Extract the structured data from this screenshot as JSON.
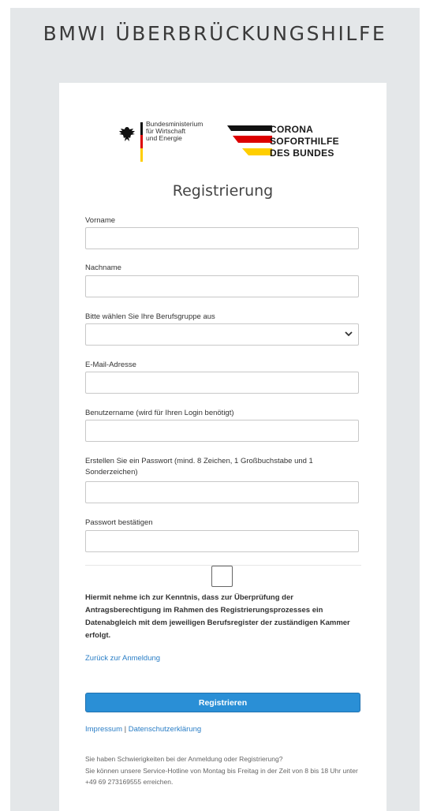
{
  "site": {
    "title": "BMWI ÜBERBRÜCKUNGSHILFE"
  },
  "logos": {
    "bm_lines": "Bundesministerium\nfür Wirtschaft\nund Energie",
    "corona": [
      "CORONA",
      "SOFORTHILFE",
      "DES BUNDES"
    ],
    "colors": {
      "black": "#111111",
      "red": "#dd0000",
      "gold": "#ffce00"
    }
  },
  "form": {
    "title": "Registrierung",
    "fields": {
      "vorname": {
        "label": "Vorname",
        "value": ""
      },
      "nachname": {
        "label": "Nachname",
        "value": ""
      },
      "berufsgruppe": {
        "label": "Bitte wählen Sie Ihre Berufsgruppe aus",
        "value": ""
      },
      "email": {
        "label": "E-Mail-Adresse",
        "value": ""
      },
      "benutzername": {
        "label": "Benutzername (wird für Ihren Login benötigt)",
        "value": ""
      },
      "passwort": {
        "label": "Erstellen Sie ein Passwort (mind. 8 Zeichen, 1 Großbuchstabe und 1 Sonderzeichen)",
        "value": ""
      },
      "passwort_bestaetigen": {
        "label": "Passwort bestätigen",
        "value": ""
      }
    },
    "consent_text": "Hiermit nehme ich zur Kenntnis, dass zur Überprüfung der Antragsberechtigung im Rahmen des Registrierungsprozesses ein Datenabgleich mit dem jeweiligen Berufsregister der zuständigen Kammer erfolgt.",
    "consent_checked": false,
    "back_link": "Zurück zur Anmeldung",
    "submit_label": "Registrieren"
  },
  "footer": {
    "impressum": "Impressum",
    "separator": "|",
    "datenschutz": "Datenschutzerklärung",
    "help_line1": "Sie haben Schwierigkeiten bei der Anmeldung oder Registrierung?",
    "help_line2": "Sie können unsere Service-Hotline von Montag bis Freitag in der Zeit von 8 bis 18 Uhr unter +49 69 273169555 erreichen."
  },
  "colors": {
    "accent": "#2a8fd6",
    "link": "#2a7ec6",
    "background": "#e4e7e9"
  }
}
